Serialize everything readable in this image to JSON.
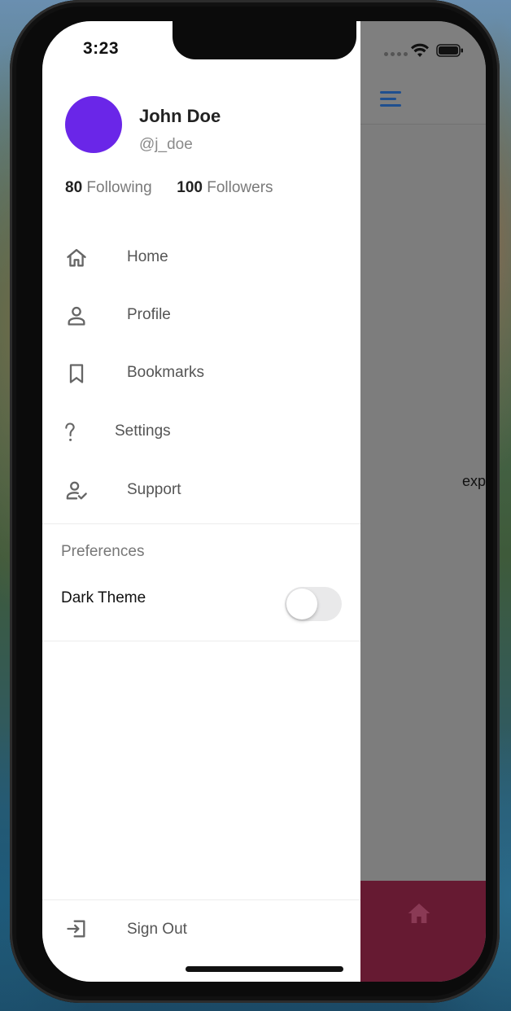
{
  "status": {
    "time": "3:23"
  },
  "profile": {
    "name": "John Doe",
    "handle": "@j_doe",
    "following_count": "80",
    "following_label": "Following",
    "followers_count": "100",
    "followers_label": "Followers"
  },
  "menu": [
    {
      "label": "Home",
      "icon": "home-icon"
    },
    {
      "label": "Profile",
      "icon": "person-icon"
    },
    {
      "label": "Bookmarks",
      "icon": "bookmark-icon"
    },
    {
      "label": "Settings",
      "icon": "question-icon"
    },
    {
      "label": "Support",
      "icon": "account-check-icon"
    }
  ],
  "preferences": {
    "title": "Preferences",
    "dark_theme_label": "Dark Theme",
    "dark_theme_on": false
  },
  "signout": {
    "label": "Sign Out",
    "icon": "exit-icon"
  },
  "main": {
    "body_text": "exp",
    "accent_color": "#661a32",
    "header_icon_color": "#1f4f8f"
  }
}
